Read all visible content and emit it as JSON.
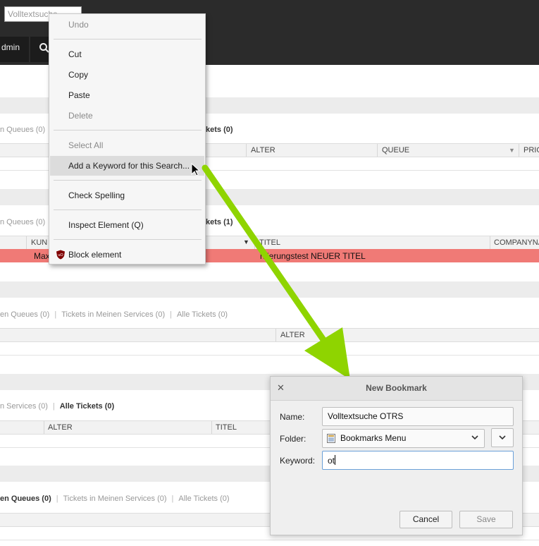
{
  "header": {
    "search_placeholder": "Volltextsuche",
    "admin_label": "dmin"
  },
  "sections": {
    "s1": {
      "filter_left": "n Queues (0)",
      "filter_right": "kets (0)",
      "col_alter": "ALTER",
      "col_queue": "QUEUE",
      "col_prio": "PRIO"
    },
    "s2": {
      "filter_left": "n Queues (0)",
      "filter_right": "kets (1)",
      "col_kunde": "KUN",
      "col_titel": "TITEL",
      "col_company": "COMPANYNA",
      "row_kunde": "Max",
      "row_titel": "rkierungstest NEUER TITEL"
    },
    "s3": {
      "f1": "en Queues (0)",
      "f2": "Tickets in Meinen Services (0)",
      "f3": "Alle Tickets (0)",
      "col_alter": "ALTER"
    },
    "s4": {
      "f1": "n Services (0)",
      "f2": "Alle Tickets (0)",
      "col_alter": "ALTER",
      "col_titel": "TITEL"
    },
    "s5": {
      "f1": "en Queues (0)",
      "f2": "Tickets in Meinen Services (0)",
      "f3": "Alle Tickets (0)"
    }
  },
  "context_menu": {
    "undo": "Undo",
    "cut": "Cut",
    "copy": "Copy",
    "paste": "Paste",
    "delete": "Delete",
    "select_all": "Select All",
    "add_keyword": "Add a Keyword for this Search...",
    "check_spelling": "Check Spelling",
    "inspect": "Inspect Element (Q)",
    "block": "Block element"
  },
  "dialog": {
    "title": "New Bookmark",
    "close": "✕",
    "name_label": "Name:",
    "name_value": "Volltextsuche OTRS",
    "folder_label": "Folder:",
    "folder_value": "Bookmarks Menu",
    "keyword_label": "Keyword:",
    "keyword_value": "ot",
    "cancel": "Cancel",
    "save": "Save"
  },
  "colors": {
    "arrow": "#8fd400",
    "highlight_row": "#f07a76",
    "topbar": "#2b2b2b"
  }
}
